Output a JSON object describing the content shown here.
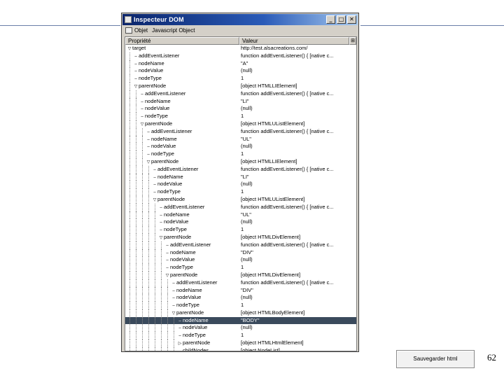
{
  "window": {
    "title": "Inspecteur DOM",
    "controls": [
      "_",
      "□",
      "✕"
    ]
  },
  "menubar": {
    "items": [
      "Objet",
      "Javascript Object"
    ]
  },
  "columns": {
    "property": "Propriété",
    "value": "Valeur",
    "picker": "⊞"
  },
  "rows": [
    {
      "label": "target",
      "value": "http://test.alsacreations.com/",
      "depth": 0,
      "twisty": "open",
      "selected": false
    },
    {
      "label": "addEventListener",
      "value": "function addEventListener() {   [native c...",
      "depth": 1,
      "twisty": "",
      "selected": false
    },
    {
      "label": "nodeName",
      "value": "\"A\"",
      "depth": 1,
      "twisty": "",
      "selected": false
    },
    {
      "label": "nodeValue",
      "value": "(null)",
      "depth": 1,
      "twisty": "",
      "selected": false
    },
    {
      "label": "nodeType",
      "value": "1",
      "depth": 1,
      "twisty": "",
      "selected": false
    },
    {
      "label": "parentNode",
      "value": "[object HTMLLIElement]",
      "depth": 1,
      "twisty": "open",
      "selected": false
    },
    {
      "label": "addEventListener",
      "value": "function addEventListener() {   [native c...",
      "depth": 2,
      "twisty": "",
      "selected": false
    },
    {
      "label": "nodeName",
      "value": "\"LI\"",
      "depth": 2,
      "twisty": "",
      "selected": false
    },
    {
      "label": "nodeValue",
      "value": "(null)",
      "depth": 2,
      "twisty": "",
      "selected": false
    },
    {
      "label": "nodeType",
      "value": "1",
      "depth": 2,
      "twisty": "",
      "selected": false
    },
    {
      "label": "parentNode",
      "value": "[object HTMLUListElement]",
      "depth": 2,
      "twisty": "open",
      "selected": false
    },
    {
      "label": "addEventListener",
      "value": "function addEventListener() {   [native c...",
      "depth": 3,
      "twisty": "",
      "selected": false
    },
    {
      "label": "nodeName",
      "value": "\"UL\"",
      "depth": 3,
      "twisty": "",
      "selected": false
    },
    {
      "label": "nodeValue",
      "value": "(null)",
      "depth": 3,
      "twisty": "",
      "selected": false
    },
    {
      "label": "nodeType",
      "value": "1",
      "depth": 3,
      "twisty": "",
      "selected": false
    },
    {
      "label": "parentNode",
      "value": "[object HTMLLIElement]",
      "depth": 3,
      "twisty": "open",
      "selected": false
    },
    {
      "label": "addEventListener",
      "value": "function addEventListener() {   [native c...",
      "depth": 4,
      "twisty": "",
      "selected": false
    },
    {
      "label": "nodeName",
      "value": "\"LI\"",
      "depth": 4,
      "twisty": "",
      "selected": false
    },
    {
      "label": "nodeValue",
      "value": "(null)",
      "depth": 4,
      "twisty": "",
      "selected": false
    },
    {
      "label": "nodeType",
      "value": "1",
      "depth": 4,
      "twisty": "",
      "selected": false
    },
    {
      "label": "parentNode",
      "value": "[object HTMLUListElement]",
      "depth": 4,
      "twisty": "open",
      "selected": false
    },
    {
      "label": "addEventListener",
      "value": "function addEventListener() {   [native c...",
      "depth": 5,
      "twisty": "",
      "selected": false
    },
    {
      "label": "nodeName",
      "value": "\"UL\"",
      "depth": 5,
      "twisty": "",
      "selected": false
    },
    {
      "label": "nodeValue",
      "value": "(null)",
      "depth": 5,
      "twisty": "",
      "selected": false
    },
    {
      "label": "nodeType",
      "value": "1",
      "depth": 5,
      "twisty": "",
      "selected": false
    },
    {
      "label": "parentNode",
      "value": "[object HTMLDivElement]",
      "depth": 5,
      "twisty": "open",
      "selected": false
    },
    {
      "label": "addEventListener",
      "value": "function addEventListener() {   [native c...",
      "depth": 6,
      "twisty": "",
      "selected": false
    },
    {
      "label": "nodeName",
      "value": "\"DIV\"",
      "depth": 6,
      "twisty": "",
      "selected": false
    },
    {
      "label": "nodeValue",
      "value": "(null)",
      "depth": 6,
      "twisty": "",
      "selected": false
    },
    {
      "label": "nodeType",
      "value": "1",
      "depth": 6,
      "twisty": "",
      "selected": false
    },
    {
      "label": "parentNode",
      "value": "[object HTMLDivElement]",
      "depth": 6,
      "twisty": "open",
      "selected": false
    },
    {
      "label": "addEventListener",
      "value": "function addEventListener() {   [native c...",
      "depth": 7,
      "twisty": "",
      "selected": false
    },
    {
      "label": "nodeName",
      "value": "\"DIV\"",
      "depth": 7,
      "twisty": "",
      "selected": false
    },
    {
      "label": "nodeValue",
      "value": "(null)",
      "depth": 7,
      "twisty": "",
      "selected": false
    },
    {
      "label": "nodeType",
      "value": "1",
      "depth": 7,
      "twisty": "",
      "selected": false
    },
    {
      "label": "parentNode",
      "value": "[object HTMLBodyElement]",
      "depth": 7,
      "twisty": "open",
      "selected": false
    },
    {
      "label": "nodeName",
      "value": "\"BODY\"",
      "depth": 8,
      "twisty": "",
      "selected": true
    },
    {
      "label": "nodeValue",
      "value": "(null)",
      "depth": 8,
      "twisty": "",
      "selected": false
    },
    {
      "label": "nodeType",
      "value": "1",
      "depth": 8,
      "twisty": "",
      "selected": false
    },
    {
      "label": "parentNode",
      "value": "[object HTMLHtmlElement]",
      "depth": 8,
      "twisty": "closed",
      "selected": false
    },
    {
      "label": "childNodes",
      "value": "[object NodeList]",
      "depth": 8,
      "twisty": "",
      "selected": false
    }
  ],
  "save_button": {
    "label": "Sauvegarder html"
  },
  "page_number": "62",
  "colors": {
    "title_bar": "#0a246a",
    "selected_row": "#3a4a5c",
    "window_face": "#d4d0c8"
  }
}
